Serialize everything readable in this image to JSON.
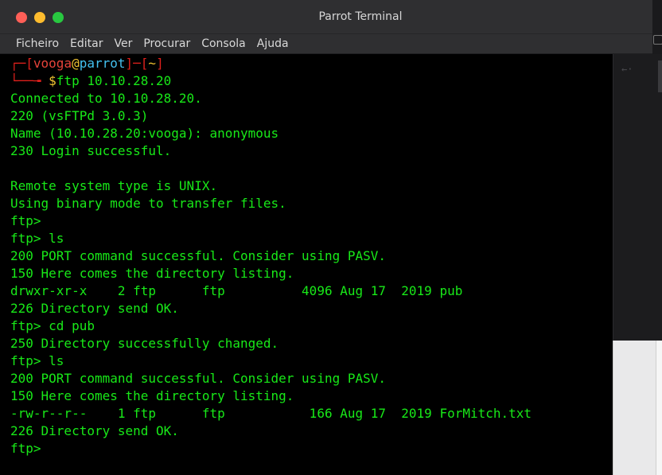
{
  "window": {
    "title": "Parrot Terminal",
    "colors": {
      "close": "#ff5f57",
      "minimize": "#febc2e",
      "maximize": "#28c840",
      "terminal_text": "#18e918",
      "prompt_bracket": "#e0201c",
      "prompt_user": "#e6433a",
      "prompt_host": "#43c1f0"
    }
  },
  "menu": {
    "items": [
      "Ficheiro",
      "Editar",
      "Ver",
      "Procurar",
      "Consola",
      "Ajuda"
    ]
  },
  "prompt": {
    "corner_top": "┌─[",
    "user": "vooga",
    "at": "@",
    "host": "parrot",
    "mid": "]─[",
    "path": "~",
    "close": "]",
    "corner_bottom": "└──╼ ",
    "dollar": "$",
    "command": "ftp 10.10.28.20"
  },
  "output": [
    "Connected to 10.10.28.20.",
    "220 (vsFTPd 3.0.3)",
    "Name (10.10.28.20:vooga): anonymous",
    "230 Login successful.",
    "",
    "Remote system type is UNIX.",
    "Using binary mode to transfer files.",
    "ftp>",
    "ftp> ls",
    "200 PORT command successful. Consider using PASV.",
    "150 Here comes the directory listing.",
    "drwxr-xr-x    2 ftp      ftp          4096 Aug 17  2019 pub",
    "226 Directory send OK.",
    "ftp> cd pub",
    "250 Directory successfully changed.",
    "ftp> ls",
    "200 PORT command successful. Consider using PASV.",
    "150 Here comes the directory listing.",
    "-rw-r--r--    1 ftp      ftp           166 Aug 17  2019 ForMitch.txt",
    "226 Directory send OK.",
    "ftp>"
  ]
}
